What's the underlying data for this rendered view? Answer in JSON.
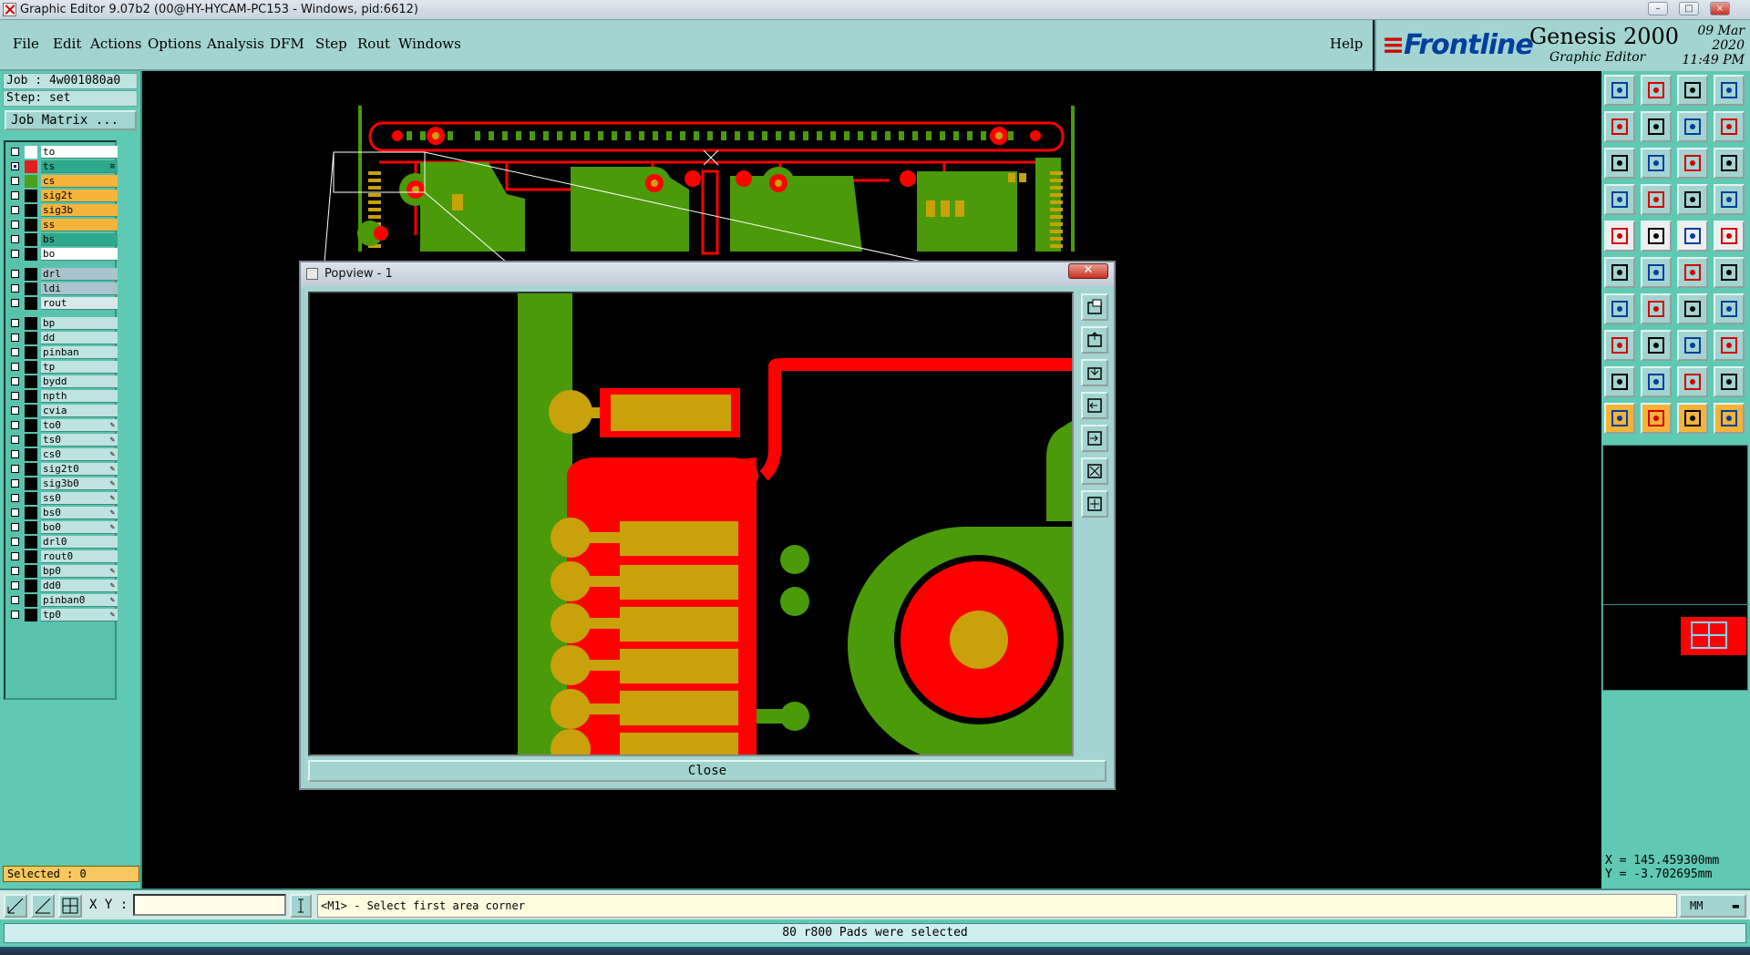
{
  "window": {
    "title": "Graphic Editor 9.07b2 (00@HY-HYCAM-PC153 - Windows, pid:6612)",
    "controls": [
      "–",
      "□",
      "×"
    ]
  },
  "menu": {
    "items": [
      "File",
      "Edit",
      "Actions",
      "Options",
      "Analysis",
      "DFM",
      "Step",
      "Rout",
      "Windows"
    ],
    "help": "Help"
  },
  "brand": {
    "logo": "Frontline",
    "product": "Genesis 2000",
    "subtitle": "Graphic Editor",
    "date": "09 Mar 2020",
    "time": "11:49 PM"
  },
  "left_panel": {
    "job": "Job : 4w001080a0",
    "step": "Step: set",
    "job_matrix": "Job Matrix ...",
    "selected": "Selected : 0"
  },
  "layers": [
    {
      "name": "to",
      "color": "#ffffff",
      "bg": "#ffffff",
      "checked": false,
      "pen": false
    },
    {
      "name": "ts",
      "color": "#e02020",
      "bg": "#2fa88c",
      "checked": true,
      "pen": false,
      "mark": "≡"
    },
    {
      "name": "cs",
      "color": "#4aa01e",
      "bg": "#f5b33a",
      "checked": false,
      "pen": false
    },
    {
      "name": "sig2t",
      "color": "#000000",
      "bg": "#f5b33a",
      "checked": false,
      "pen": false
    },
    {
      "name": "sig3b",
      "color": "#000000",
      "bg": "#f5b33a",
      "checked": false,
      "pen": false
    },
    {
      "name": "ss",
      "color": "#000000",
      "bg": "#f5b33a",
      "checked": false,
      "pen": false
    },
    {
      "name": "bs",
      "color": "#000000",
      "bg": "#2fa88c",
      "checked": false,
      "pen": false
    },
    {
      "name": "bo",
      "color": "#000000",
      "bg": "#ffffff",
      "checked": false,
      "pen": false
    },
    {
      "name": "drl",
      "color": "#000000",
      "bg": "#a9c4cc",
      "checked": false,
      "pen": false
    },
    {
      "name": "ldi",
      "color": "#000000",
      "bg": "#a9c4cc",
      "checked": false,
      "pen": false
    },
    {
      "name": "rout",
      "color": "#000000",
      "bg": "#d8e8ea",
      "checked": false,
      "pen": false
    },
    {
      "name": "bp",
      "color": "#000000",
      "bg": "#bfe3e0",
      "checked": false,
      "pen": false
    },
    {
      "name": "dd",
      "color": "#000000",
      "bg": "#bfe3e0",
      "checked": false,
      "pen": false
    },
    {
      "name": "pinban",
      "color": "#000000",
      "bg": "#bfe3e0",
      "checked": false,
      "pen": false
    },
    {
      "name": "tp",
      "color": "#000000",
      "bg": "#bfe3e0",
      "checked": false,
      "pen": false
    },
    {
      "name": "bydd",
      "color": "#000000",
      "bg": "#bfe3e0",
      "checked": false,
      "pen": false
    },
    {
      "name": "npth",
      "color": "#000000",
      "bg": "#bfe3e0",
      "checked": false,
      "pen": false
    },
    {
      "name": "cvia",
      "color": "#000000",
      "bg": "#bfe3e0",
      "checked": false,
      "pen": false
    },
    {
      "name": "to0",
      "color": "#000000",
      "bg": "#bfe3e0",
      "checked": false,
      "pen": true
    },
    {
      "name": "ts0",
      "color": "#000000",
      "bg": "#bfe3e0",
      "checked": false,
      "pen": true
    },
    {
      "name": "cs0",
      "color": "#000000",
      "bg": "#bfe3e0",
      "checked": false,
      "pen": true
    },
    {
      "name": "sig2t0",
      "color": "#000000",
      "bg": "#bfe3e0",
      "checked": false,
      "pen": true
    },
    {
      "name": "sig3b0",
      "color": "#000000",
      "bg": "#bfe3e0",
      "checked": false,
      "pen": true
    },
    {
      "name": "ss0",
      "color": "#000000",
      "bg": "#bfe3e0",
      "checked": false,
      "pen": true
    },
    {
      "name": "bs0",
      "color": "#000000",
      "bg": "#bfe3e0",
      "checked": false,
      "pen": true
    },
    {
      "name": "bo0",
      "color": "#000000",
      "bg": "#bfe3e0",
      "checked": false,
      "pen": true
    },
    {
      "name": "drl0",
      "color": "#000000",
      "bg": "#bfe3e0",
      "checked": false,
      "pen": false
    },
    {
      "name": "rout0",
      "color": "#000000",
      "bg": "#bfe3e0",
      "checked": false,
      "pen": false
    },
    {
      "name": "bp0",
      "color": "#000000",
      "bg": "#bfe3e0",
      "checked": false,
      "pen": true
    },
    {
      "name": "dd0",
      "color": "#000000",
      "bg": "#bfe3e0",
      "checked": false,
      "pen": true
    },
    {
      "name": "pinban0",
      "color": "#000000",
      "bg": "#bfe3e0",
      "checked": false,
      "pen": true
    },
    {
      "name": "tp0",
      "color": "#000000",
      "bg": "#bfe3e0",
      "checked": false,
      "pen": true
    }
  ],
  "popview": {
    "title": "Popview - 1",
    "close_x": "✕",
    "close_label": "Close"
  },
  "coords": {
    "x": "X = 145.459300mm",
    "y": "Y = -3.702695mm"
  },
  "command": {
    "xy_label": "X Y :",
    "xy_value": "",
    "prompt": "<M1> - Select first area corner",
    "units": "MM"
  },
  "status": "80 r800 Pads were selected",
  "colors": {
    "panel": "#a3d4d1",
    "accent": "#5fc9b4",
    "copper_red": "#ff0000",
    "copper_green": "#4a9a0a",
    "pad_gold": "#c9a10a"
  }
}
